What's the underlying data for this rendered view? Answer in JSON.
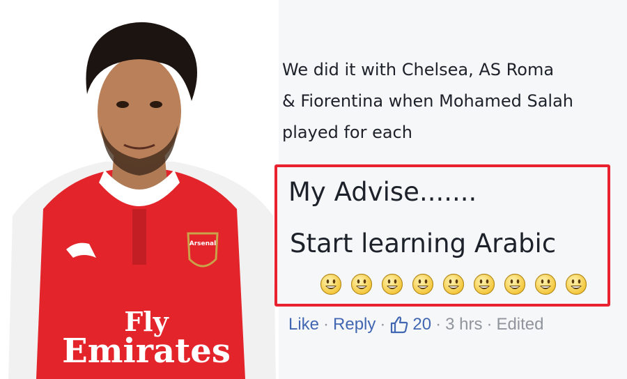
{
  "photo": {
    "shirt_text_line1": "Fly",
    "shirt_text_line2": "Emirates",
    "badge_text": "Arsenal"
  },
  "comment": {
    "lines": [
      "We did it with Chelsea, AS Roma",
      "& Fiorentina  when Mohamed Salah",
      "played for each"
    ],
    "highlight": {
      "line1": "My Advise.......",
      "line2": "Start learning Arabic",
      "emoji_icon": "grinning-face-icon",
      "emoji_count": 9
    }
  },
  "actions": {
    "like_label": "Like",
    "reply_label": "Reply",
    "separator": "·",
    "like_icon": "thumbs-up-icon",
    "like_count": "20",
    "time": "3 hrs",
    "edited": "Edited"
  },
  "colors": {
    "link": "#4267b2",
    "meta": "#90949c",
    "text": "#1d2129",
    "highlight_border": "#e8232f",
    "background": "#f6f7f9"
  }
}
